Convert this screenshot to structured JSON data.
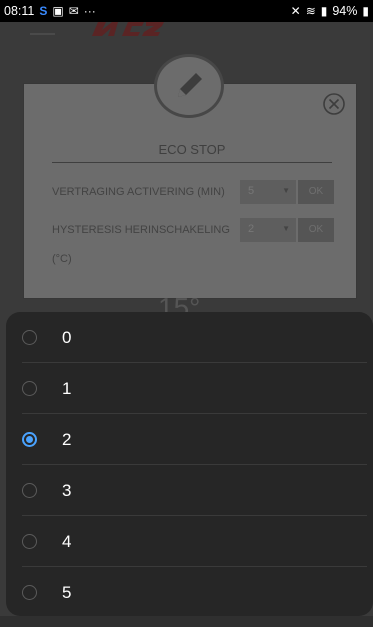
{
  "status_bar": {
    "time": "08:11",
    "battery": "94%",
    "icons": [
      "s-app-icon",
      "image-icon",
      "mail-icon",
      "more-icon",
      "mute-icon",
      "wifi-icon",
      "signal-icon",
      "battery-icon"
    ]
  },
  "modal": {
    "title": "ECO STOP",
    "rows": [
      {
        "label": "VERTRAGING ACTIVERING (MIN)",
        "value": "5",
        "ok": "OK"
      },
      {
        "label": "HYSTERESIS HERINSCHAKELING",
        "value": "2",
        "ok": "OK"
      }
    ],
    "unit_line": "(°C)"
  },
  "options": [
    {
      "label": "0",
      "checked": false
    },
    {
      "label": "1",
      "checked": false
    },
    {
      "label": "2",
      "checked": true
    },
    {
      "label": "3",
      "checked": false
    },
    {
      "label": "4",
      "checked": false
    },
    {
      "label": "5",
      "checked": false
    }
  ],
  "colors": {
    "accent": "#4aa3ff",
    "sheet_bg": "#262626",
    "modal_bg": "#6c6c6c"
  }
}
